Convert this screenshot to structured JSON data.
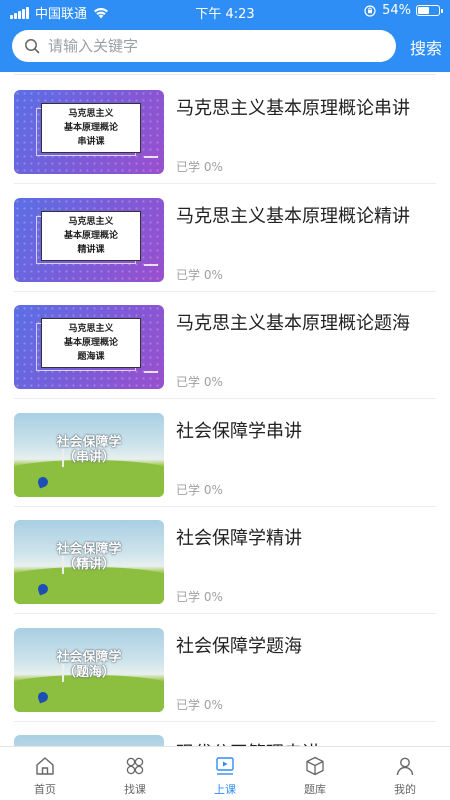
{
  "status_bar": {
    "carrier": "中国联通",
    "time": "下午 4:23",
    "battery": "54%",
    "battery_level": 0.54
  },
  "search": {
    "placeholder": "请输入关键字",
    "button_label": "搜索"
  },
  "courses": [
    {
      "title": "马克思主义基本原理概论串讲",
      "progress": "已学 0%",
      "thumb_style": "purple",
      "thumb_lines": [
        "马克思主义",
        "基本原理概论",
        "串讲课"
      ]
    },
    {
      "title": "马克思主义基本原理概论精讲",
      "progress": "已学 0%",
      "thumb_style": "purple",
      "thumb_lines": [
        "马克思主义",
        "基本原理概论",
        "精讲课"
      ]
    },
    {
      "title": "马克思主义基本原理概论题海",
      "progress": "已学 0%",
      "thumb_style": "purple",
      "thumb_lines": [
        "马克思主义",
        "基本原理概论",
        "题海课"
      ]
    },
    {
      "title": "社会保障学串讲",
      "progress": "已学 0%",
      "thumb_style": "green",
      "thumb_lines": [
        "社会保障学",
        "（串讲）"
      ]
    },
    {
      "title": "社会保障学精讲",
      "progress": "已学 0%",
      "thumb_style": "green",
      "thumb_lines": [
        "社会保障学",
        "（精讲）"
      ]
    },
    {
      "title": "社会保障学题海",
      "progress": "已学 0%",
      "thumb_style": "green",
      "thumb_lines": [
        "社会保障学",
        "（题海）"
      ]
    },
    {
      "title": "现代公司管理串讲",
      "progress": "",
      "thumb_style": "green",
      "thumb_lines": [
        "",
        ""
      ]
    }
  ],
  "tabbar": {
    "items": [
      {
        "label": "首页",
        "icon": "home-icon"
      },
      {
        "label": "找课",
        "icon": "find-course-icon"
      },
      {
        "label": "上课",
        "icon": "class-icon"
      },
      {
        "label": "题库",
        "icon": "question-bank-icon"
      },
      {
        "label": "我的",
        "icon": "profile-icon"
      }
    ],
    "active_index": 2
  },
  "colors": {
    "primary": "#2f8ef6",
    "inactive": "#666666",
    "progress_text": "#a0a0a0"
  }
}
